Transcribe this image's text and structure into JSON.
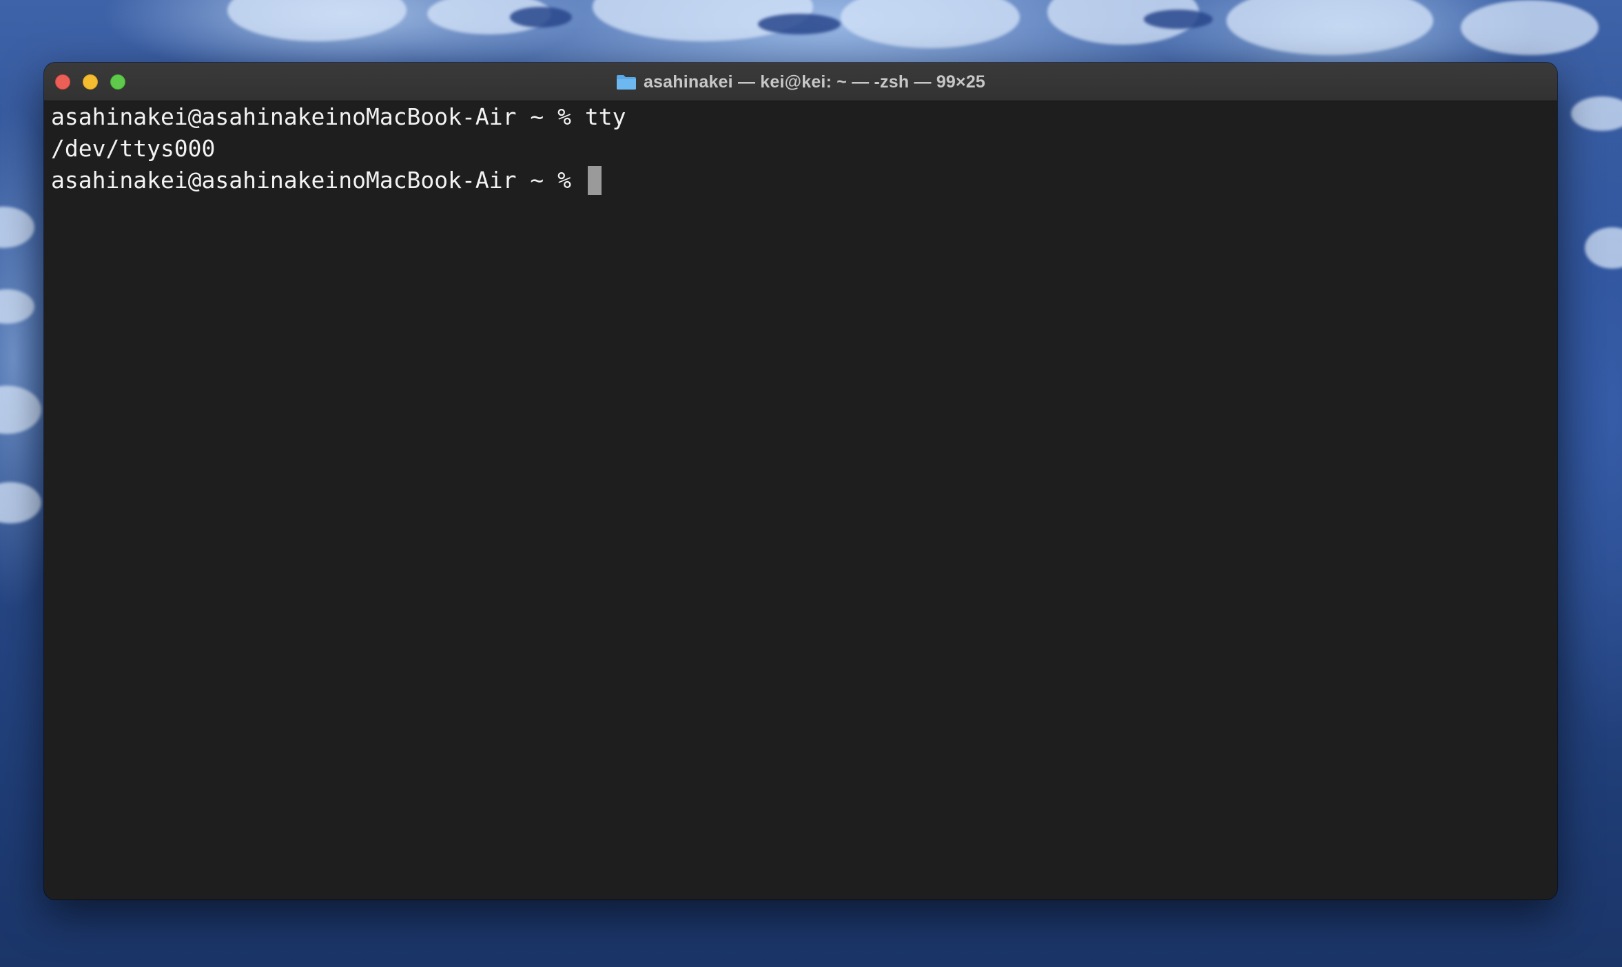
{
  "window": {
    "title": "asahinakei — kei@kei: ~ — -zsh — 99×25",
    "title_icon": "folder-icon",
    "controls": {
      "close": "close-button",
      "minimize": "minimize-button",
      "zoom": "zoom-button"
    }
  },
  "terminal": {
    "lines": [
      {
        "text": "asahinakei@asahinakeinoMacBook-Air ~ % tty"
      },
      {
        "text": "/dev/ttys000"
      },
      {
        "text": "asahinakei@asahinakeinoMacBook-Air ~ % "
      }
    ]
  },
  "colors": {
    "terminal_background": "#1e1e1e",
    "terminal_text": "#f2f2f2",
    "cursor": "#9a9a9a",
    "close": "#ec5f57",
    "minimize": "#f4bd2f",
    "zoom": "#5ec94a",
    "folder_icon": "#5aa9e6"
  }
}
